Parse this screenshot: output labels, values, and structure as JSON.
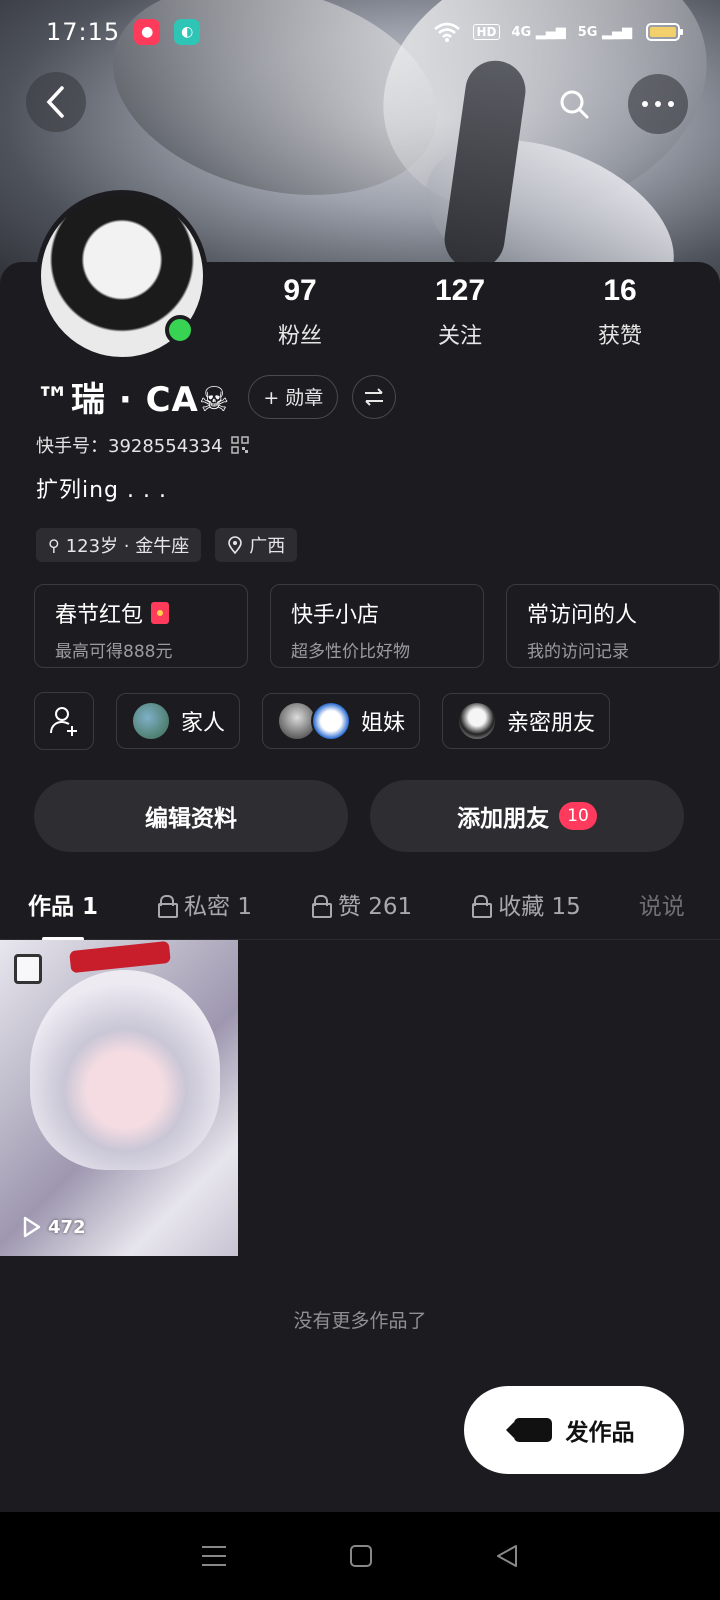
{
  "status_bar": {
    "time": "17:15",
    "hd": "HD",
    "net1": "4G",
    "net2": "5G"
  },
  "profile": {
    "stats": [
      {
        "value": "97",
        "label": "粉丝"
      },
      {
        "value": "127",
        "label": "关注"
      },
      {
        "value": "16",
        "label": "获赞"
      }
    ],
    "nickname": "™瑞 · CA☠",
    "badge_button": "+ 勋章",
    "kuaishou_id": "快手号：3928554334",
    "bio": "扩列ing . . .",
    "tags": [
      {
        "icon": "gender-icon",
        "text": "123岁 · 金牛座"
      },
      {
        "icon": "location-icon",
        "text": "广西"
      }
    ]
  },
  "feature_cards": [
    {
      "title": "春节红包",
      "subtitle": "最高可得888元"
    },
    {
      "title": "快手小店",
      "subtitle": "超多性价比好物"
    },
    {
      "title": "常访问的人",
      "subtitle": "我的访问记录"
    }
  ],
  "groups": [
    {
      "label": "家人"
    },
    {
      "label": "姐妹"
    },
    {
      "label": "亲密朋友"
    }
  ],
  "actions": {
    "edit": "编辑资料",
    "add_friend": "添加朋友",
    "add_friend_count": "10"
  },
  "tabs": [
    {
      "label": "作品 1",
      "locked": false
    },
    {
      "label": "私密 1",
      "locked": true
    },
    {
      "label": "赞 261",
      "locked": true
    },
    {
      "label": "收藏 15",
      "locked": true
    },
    {
      "label": "说说",
      "locked": false
    }
  ],
  "works": [
    {
      "plays": "472"
    }
  ],
  "no_more_text": "没有更多作品了",
  "publish_button": "发作品",
  "colors": {
    "background": "#1c1c20",
    "online": "#39d353",
    "badge": "#ff3a5c",
    "accent_red": "#ff3b5c"
  }
}
